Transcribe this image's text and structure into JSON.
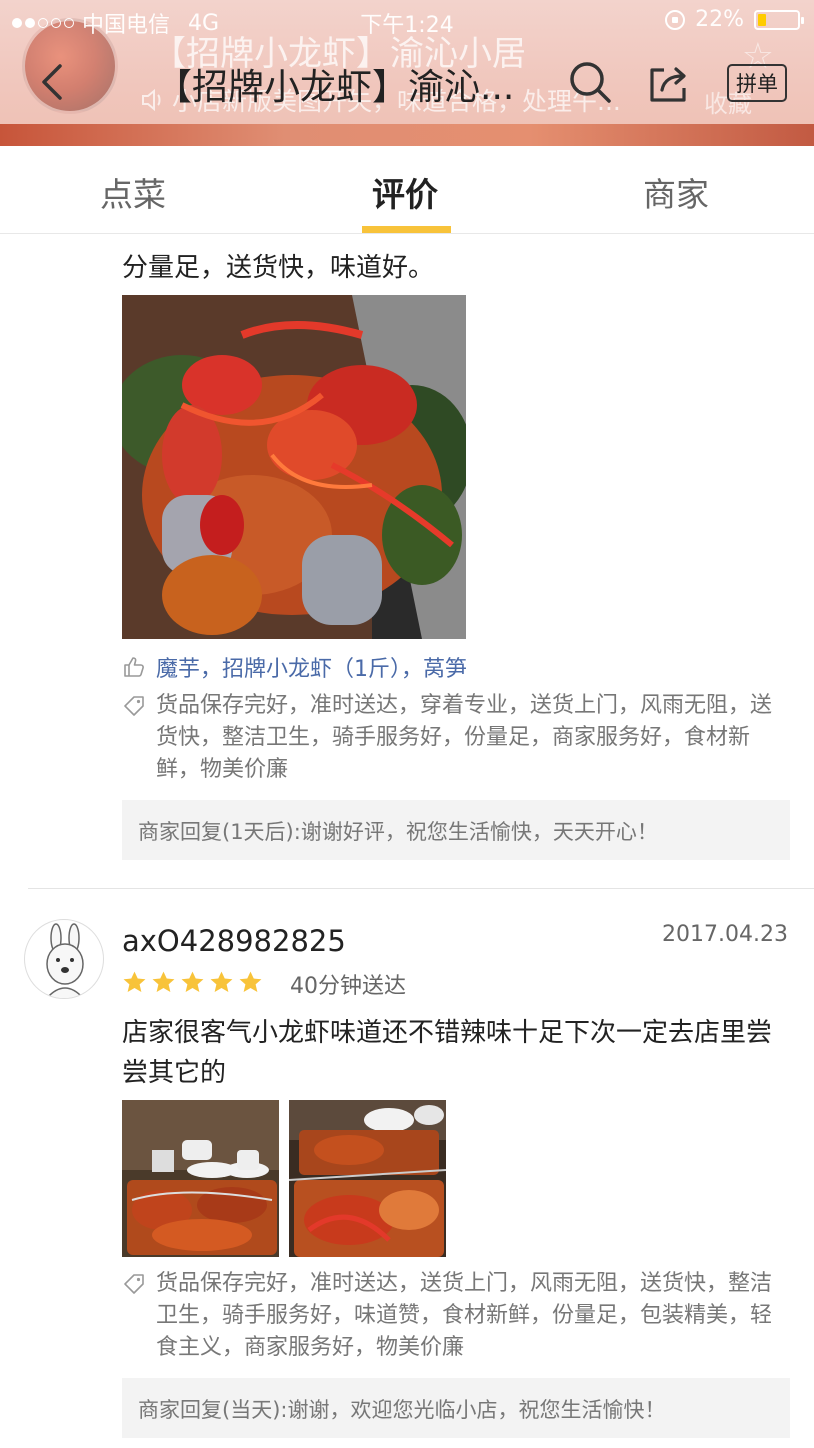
{
  "status_bar": {
    "carrier": "中国电信",
    "network": "4G",
    "time": "下午1:24",
    "battery": "22%",
    "battery_level": 0.22
  },
  "header": {
    "title": "【招牌小龙虾】渝沁...",
    "ghost_title": "【招牌小龙虾】渝沁小居",
    "ghost_notice": "小店新版美图开失，味道合格，处理午...",
    "ghost_right": "收藏",
    "pindan_label": "拼单",
    "back_icon": "back-chevron-icon",
    "search_icon": "search-icon",
    "share_icon": "share-icon"
  },
  "tabs": [
    {
      "label": "点菜",
      "active": false
    },
    {
      "label": "评价",
      "active": true
    },
    {
      "label": "商家",
      "active": false
    }
  ],
  "reviews": [
    {
      "text": "分量足，送货快，味道好。",
      "dishes": "魔芋，招牌小龙虾（1斤），莴笋",
      "tags": "货品保存完好，准时送达，穿着专业，送货上门，风雨无阻，送货快，整洁卫生，骑手服务好，份量足，商家服务好，食材新鲜，物美价廉",
      "reply": "商家回复(1天后):谢谢好评，祝您生活愉快，天天开心！"
    },
    {
      "username": "axO428982825",
      "date": "2017.04.23",
      "rating": 5,
      "delivery_time": "40分钟送达",
      "text": "店家很客气小龙虾味道还不错辣味十足下次一定去店里尝尝其它的",
      "tags": "货品保存完好，准时送达，送货上门，风雨无阻，送货快，整洁卫生，骑手服务好，味道赞，食材新鲜，份量足，包装精美，轻食主义，商家服务好，物美价廉",
      "reply": "商家回复(当天):谢谢，欢迎您光临小店，祝您生活愉快！"
    }
  ],
  "colors": {
    "tab_indicator": "#f8c33a",
    "star": "#f8c33a",
    "dish_link": "#4a6aa8"
  }
}
